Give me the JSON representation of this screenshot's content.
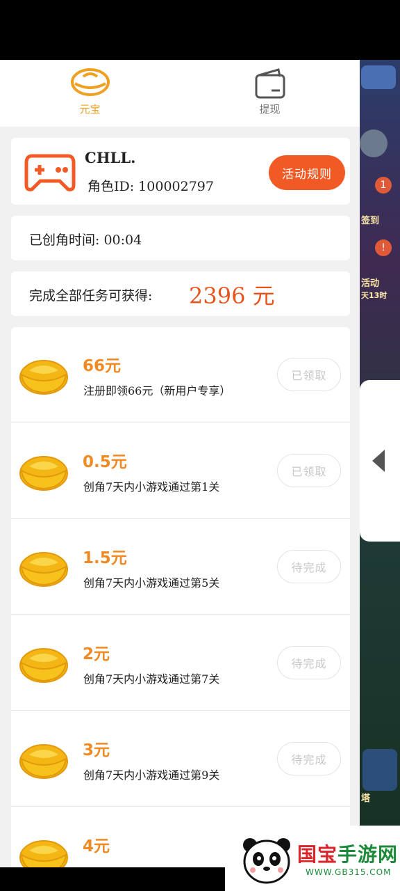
{
  "tabs": [
    {
      "label": "元宝",
      "active": true,
      "icon": "ingot-icon"
    },
    {
      "label": "提现",
      "active": false,
      "icon": "wallet-icon"
    }
  ],
  "user": {
    "name": "CHLL.",
    "role_id": "角色ID:  100002797",
    "rules_button": "活动规则"
  },
  "created_time": "已创角时间:  00:04",
  "total": {
    "label": "完成全部任务可获得:",
    "amount": "2396 元"
  },
  "tasks": [
    {
      "amount": "66元",
      "desc": "注册即领66元（新用户专享）",
      "status": "已领取"
    },
    {
      "amount": "0.5元",
      "desc": "创角7天内小游戏通过第1关",
      "status": "已领取"
    },
    {
      "amount": "1.5元",
      "desc": "创角7天内小游戏通过第5关",
      "status": "待完成"
    },
    {
      "amount": "2元",
      "desc": "创角7天内小游戏通过第7关",
      "status": "待完成"
    },
    {
      "amount": "3元",
      "desc": "创角7天内小游戏通过第9关",
      "status": "待完成"
    },
    {
      "amount": "4元",
      "desc": "",
      "status": ""
    }
  ],
  "background": {
    "labels": [
      "签到",
      "活动",
      "天13时",
      "塔"
    ],
    "badges": [
      "1",
      "!"
    ]
  },
  "watermark": {
    "brand_part1": "国宝",
    "brand_part2": "手游网",
    "site": "WWW.GB315.COM"
  },
  "colors": {
    "accent_orange": "#f15a24",
    "amount_orange": "#f08a24",
    "total_red": "#e8541c",
    "tab_active": "#f0a020"
  }
}
